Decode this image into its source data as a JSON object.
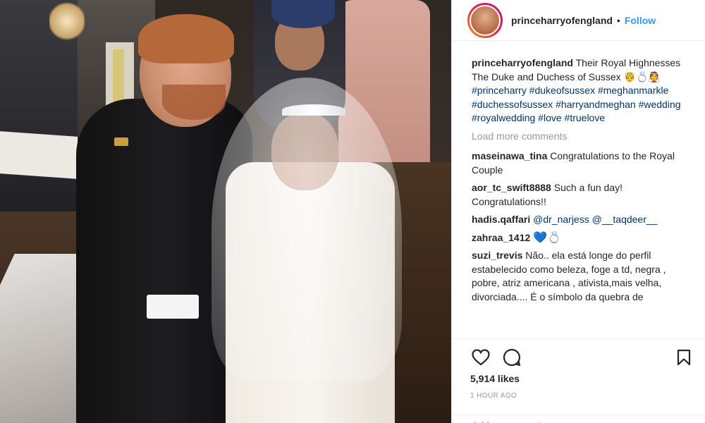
{
  "post": {
    "image_alt": "Wedding photo"
  },
  "header": {
    "username": "princeharryofengland",
    "separator": "•",
    "follow_label": "Follow"
  },
  "caption": {
    "username": "princeharryofengland",
    "text": "Their Royal Highnesses The Duke and Duchess of Sussex 🤴💍👰",
    "hashtags": "#princeharry #dukeofsussex #meghanmarkle #duchessofsussex #harryandmeghan #wedding #royalwedding #love #truelove"
  },
  "load_more": "Load more comments",
  "comments": [
    {
      "username": "maseinawa_tina",
      "text": "Congratulations to the Royal Couple"
    },
    {
      "username": "aor_tc_swift8888",
      "text": "Such a fun day! Congratulations!!"
    },
    {
      "username": "hadis.qaffari",
      "text": "@dr_narjess @__taqdeer__"
    },
    {
      "username": "zahraa_1412",
      "text": "💙💍"
    },
    {
      "username": "suzi_trevis",
      "text": "Não.. ela está longe do perfil estabelecido como beleza, foge a td, negra , pobre, atriz americana , ativista,mais velha, divorciada.... É o símbolo da quebra de"
    }
  ],
  "actions": {
    "like_icon": "heart-outline-icon",
    "comment_icon": "comment-bubble-icon",
    "save_icon": "bookmark-icon"
  },
  "likes": "5,914 likes",
  "timestamp": "1 HOUR AGO",
  "add_comment_placeholder": "Add a comment..."
}
